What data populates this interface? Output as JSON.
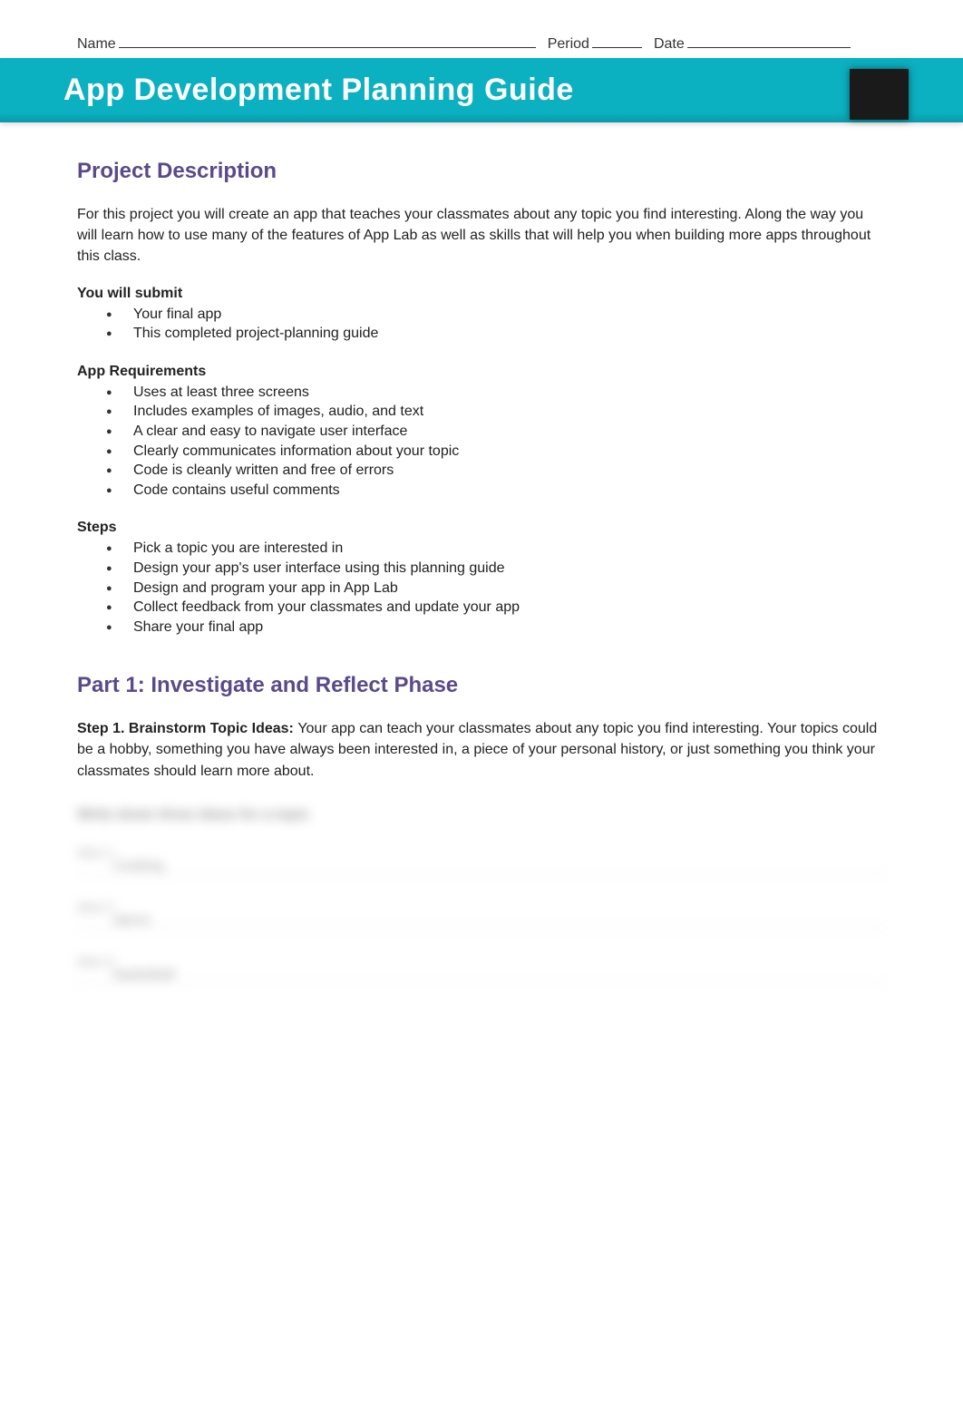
{
  "header": {
    "name_label": "Name",
    "period_label": "Period",
    "date_label": "Date"
  },
  "banner": {
    "title": "App Development Planning Guide"
  },
  "project_description": {
    "heading": "Project Description",
    "intro": "For this project you will create an app that teaches your classmates about any topic you find interesting. Along the way you will learn how to use many of the features of App Lab as well as skills that will help you when building more apps throughout this class.",
    "submit_heading": "You will submit",
    "submit_items": [
      "Your final app",
      "This completed project-planning guide"
    ],
    "requirements_heading": "App Requirements",
    "requirements_items": [
      "Uses at least three screens",
      "Includes examples of images, audio, and text",
      "A clear and easy to navigate user interface",
      "Clearly communicates information about your topic",
      "Code is cleanly written and free of errors",
      "Code contains useful comments"
    ],
    "steps_heading": "Steps",
    "steps_items": [
      "Pick a topic you are interested in",
      "Design your app's user interface using this planning guide",
      "Design and program your app in App Lab",
      "Collect feedback from your classmates and update your app",
      "Share your final app"
    ]
  },
  "part1": {
    "heading": "Part 1: Investigate and Reflect Phase",
    "step1_label": "Step 1. Brainstorm Topic Ideas: ",
    "step1_text": "Your app can teach your classmates about any topic you find interesting. Your topics could be a hobby, something you have always been interested in, a piece of your personal history, or just something you think your classmates should learn more about."
  },
  "blurred": {
    "ideas_heading": "Write down three ideas for a topic",
    "idea1_label": "Idea 1:",
    "idea1_value": "Cooking",
    "idea2_label": "Idea 2:",
    "idea2_value": "dance",
    "idea3_label": "Idea 3:",
    "idea3_value": "basketball"
  }
}
